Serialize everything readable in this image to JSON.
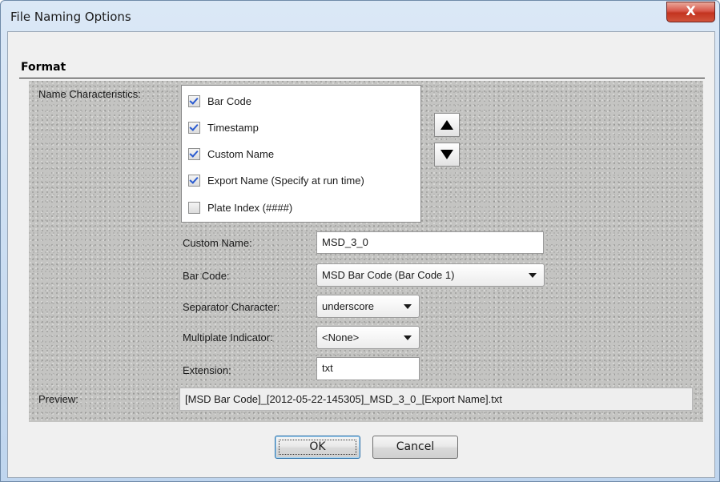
{
  "window": {
    "title": "File Naming Options",
    "close_glyph": "X"
  },
  "section": {
    "title": "Format"
  },
  "name_characteristics": {
    "label": "Name Characteristics:",
    "items": [
      {
        "label": "Bar Code",
        "checked": true
      },
      {
        "label": "Timestamp",
        "checked": true
      },
      {
        "label": "Custom Name",
        "checked": true
      },
      {
        "label": "Export Name (Specify at run time)",
        "checked": true
      },
      {
        "label": "Plate Index (####)",
        "checked": false
      }
    ],
    "move_up_icon": "triangle-up-icon",
    "move_down_icon": "triangle-down-icon"
  },
  "form": {
    "custom_name": {
      "label": "Custom Name:",
      "value": "MSD_3_0"
    },
    "bar_code": {
      "label": "Bar Code:",
      "value": "MSD Bar Code (Bar Code 1)"
    },
    "separator": {
      "label": "Separator Character:",
      "value": "underscore"
    },
    "multiplate": {
      "label": "Multiplate Indicator:",
      "value": "<None>"
    },
    "extension": {
      "label": "Extension:",
      "value": "txt"
    }
  },
  "preview": {
    "label": "Preview:",
    "value": "[MSD Bar Code]_[2012-05-22-145305]_MSD_3_0_[Export Name].txt"
  },
  "buttons": {
    "ok": "OK",
    "cancel": "Cancel"
  },
  "colors": {
    "title_bar": "#c9dcf1",
    "close_button": "#c3341f",
    "panel_texture": "#c4c4c2",
    "checkmark": "#2a5bd0"
  }
}
